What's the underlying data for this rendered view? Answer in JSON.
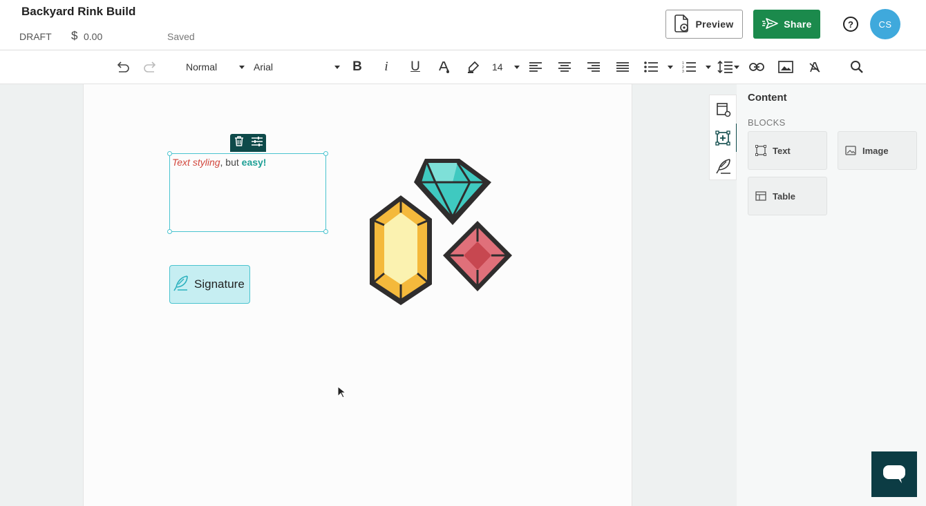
{
  "header": {
    "doc_title": "Backyard Rink Build",
    "status": "DRAFT",
    "currency_symbol": "$",
    "price": "0.00",
    "save_state": "Saved",
    "preview_label": "Preview",
    "share_label": "Share",
    "help_icon": "question-circle-icon",
    "avatar_initials": "CS",
    "share_color": "#1b8a4c",
    "avatar_color": "#3fa9dc"
  },
  "toolbar": {
    "paragraph_style": "Normal",
    "font": "Arial",
    "font_size": "14",
    "bold": "B",
    "italic": "i",
    "underline": "U"
  },
  "canvas": {
    "text_block": {
      "part1": "Text styling",
      "part2": ", but ",
      "part3": "easy!"
    },
    "signature_label": "Signature",
    "image_icon": "gems-image"
  },
  "panel": {
    "title": "Content",
    "section": "BLOCKS",
    "blocks": [
      {
        "label": "Text",
        "icon": "text-block-icon"
      },
      {
        "label": "Image",
        "icon": "image-block-icon"
      },
      {
        "label": "Table",
        "icon": "table-block-icon"
      }
    ]
  },
  "colors": {
    "accent_teal": "#49c3cf",
    "dark_teal": "#0e4a4a",
    "italic_red": "#d2473d",
    "bold_teal": "#1ea096"
  }
}
